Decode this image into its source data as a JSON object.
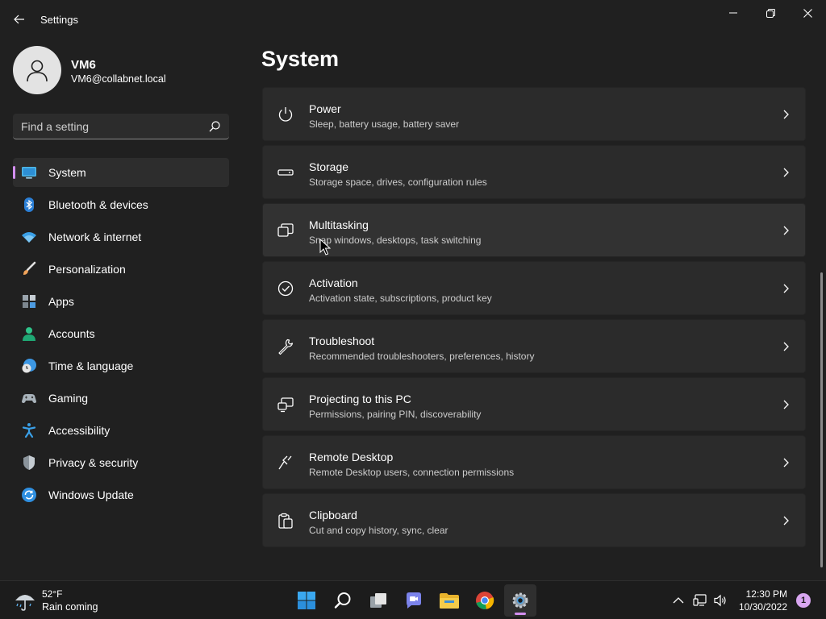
{
  "window": {
    "title": "Settings"
  },
  "profile": {
    "name": "VM6",
    "email": "VM6@collabnet.local"
  },
  "search": {
    "placeholder": "Find a setting"
  },
  "sidebar": {
    "items": [
      {
        "label": "System",
        "icon": "system-display-icon",
        "active": true
      },
      {
        "label": "Bluetooth & devices",
        "icon": "bluetooth-icon"
      },
      {
        "label": "Network & internet",
        "icon": "wifi-icon"
      },
      {
        "label": "Personalization",
        "icon": "brush-icon"
      },
      {
        "label": "Apps",
        "icon": "apps-icon"
      },
      {
        "label": "Accounts",
        "icon": "person-icon"
      },
      {
        "label": "Time & language",
        "icon": "clock-globe-icon"
      },
      {
        "label": "Gaming",
        "icon": "gamepad-icon"
      },
      {
        "label": "Accessibility",
        "icon": "accessibility-icon"
      },
      {
        "label": "Privacy & security",
        "icon": "shield-icon"
      },
      {
        "label": "Windows Update",
        "icon": "update-icon"
      }
    ]
  },
  "main": {
    "title": "System",
    "cards": [
      {
        "title": "Power",
        "desc": "Sleep, battery usage, battery saver",
        "icon": "power-icon"
      },
      {
        "title": "Storage",
        "desc": "Storage space, drives, configuration rules",
        "icon": "storage-icon"
      },
      {
        "title": "Multitasking",
        "desc": "Snap windows, desktops, task switching",
        "icon": "multitasking-icon"
      },
      {
        "title": "Activation",
        "desc": "Activation state, subscriptions, product key",
        "icon": "activation-icon"
      },
      {
        "title": "Troubleshoot",
        "desc": "Recommended troubleshooters, preferences, history",
        "icon": "wrench-icon"
      },
      {
        "title": "Projecting to this PC",
        "desc": "Permissions, pairing PIN, discoverability",
        "icon": "projecting-icon"
      },
      {
        "title": "Remote Desktop",
        "desc": "Remote Desktop users, connection permissions",
        "icon": "remote-desktop-icon"
      },
      {
        "title": "Clipboard",
        "desc": "Cut and copy history, sync, clear",
        "icon": "clipboard-icon"
      }
    ]
  },
  "taskbar": {
    "weather": {
      "temp": "52°F",
      "desc": "Rain coming"
    },
    "apps": [
      "start-icon",
      "search-icon",
      "task-view-icon",
      "teams-chat-icon",
      "file-explorer-icon",
      "chrome-icon",
      "settings-icon"
    ],
    "clock": {
      "time": "12:30 PM",
      "date": "10/30/2022"
    },
    "notification_count": "1"
  },
  "colors": {
    "accent": "#d38ff0",
    "background": "#202020",
    "card": "#2b2b2b"
  }
}
